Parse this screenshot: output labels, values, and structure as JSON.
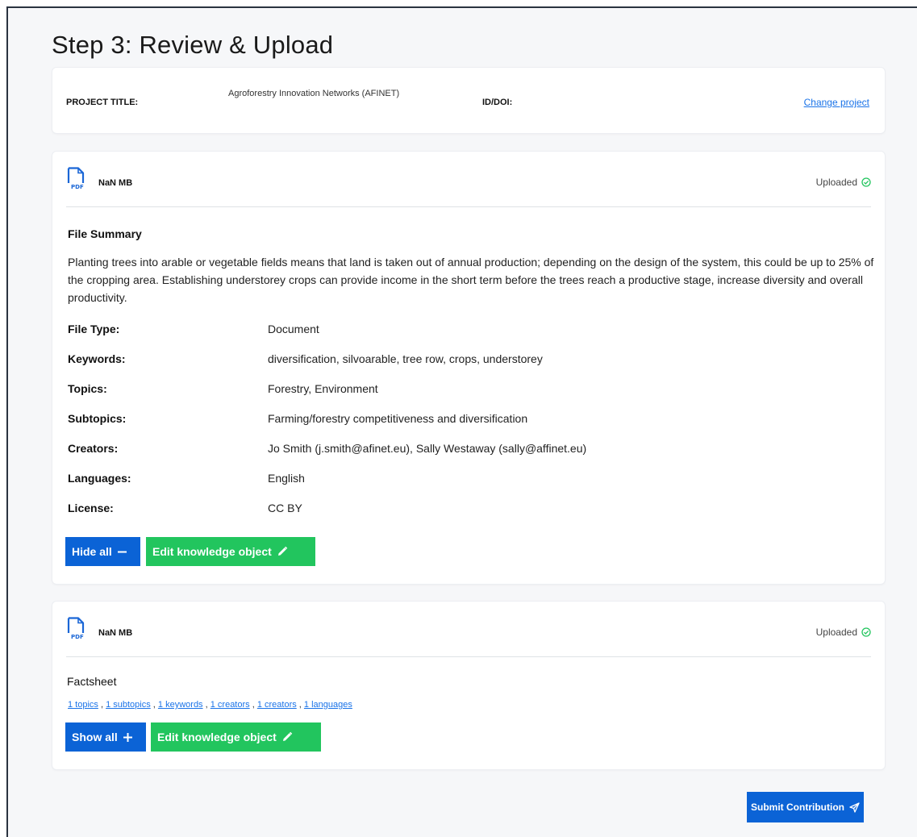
{
  "page": {
    "title": "Step 3: Review & Upload"
  },
  "project": {
    "title_label": "PROJECT TITLE:",
    "title_value": "Agroforestry Innovation Networks (AFINET)",
    "id_label": "ID/DOI:",
    "change_link": "Change project"
  },
  "file1": {
    "icon": "pdf-icon",
    "size": "NaN MB",
    "status": "Uploaded",
    "summary_heading": "File Summary",
    "summary_text": "Planting trees into arable or vegetable fields means that land is taken out of annual production; depending on the design of the system, this could be up to 25% of the cropping area. Establishing understorey crops can provide income in the short term before the trees reach a productive stage, increase diversity and overall productivity.",
    "meta": [
      {
        "key": "File Type:",
        "value": "Document"
      },
      {
        "key": "Keywords:",
        "value": "diversification, silvoarable, tree row, crops, understorey"
      },
      {
        "key": "Topics:",
        "value": "Forestry, Environment"
      },
      {
        "key": "Subtopics:",
        "value": "Farming/forestry competitiveness and diversification"
      },
      {
        "key": "Creators:",
        "value": "Jo Smith (j.smith@afinet.eu), Sally Westaway (sally@affinet.eu)"
      },
      {
        "key": "Languages:",
        "value": "English"
      },
      {
        "key": "License:",
        "value": "CC BY"
      }
    ],
    "hide_button": "Hide all",
    "edit_button": "Edit knowledge object"
  },
  "file2": {
    "icon": "pdf-icon",
    "size": "NaN MB",
    "status": "Uploaded",
    "title": "Factsheet",
    "chips": [
      "1 topics",
      "1 subtopics",
      "1 keywords",
      "1 creators",
      "1 creators",
      "1 languages"
    ],
    "show_button": "Show all",
    "edit_button": "Edit knowledge object"
  },
  "submit_button": "Submit Contribution",
  "colors": {
    "primary": "#0b63d6",
    "success": "#22c55e",
    "link": "#1a73e8"
  }
}
